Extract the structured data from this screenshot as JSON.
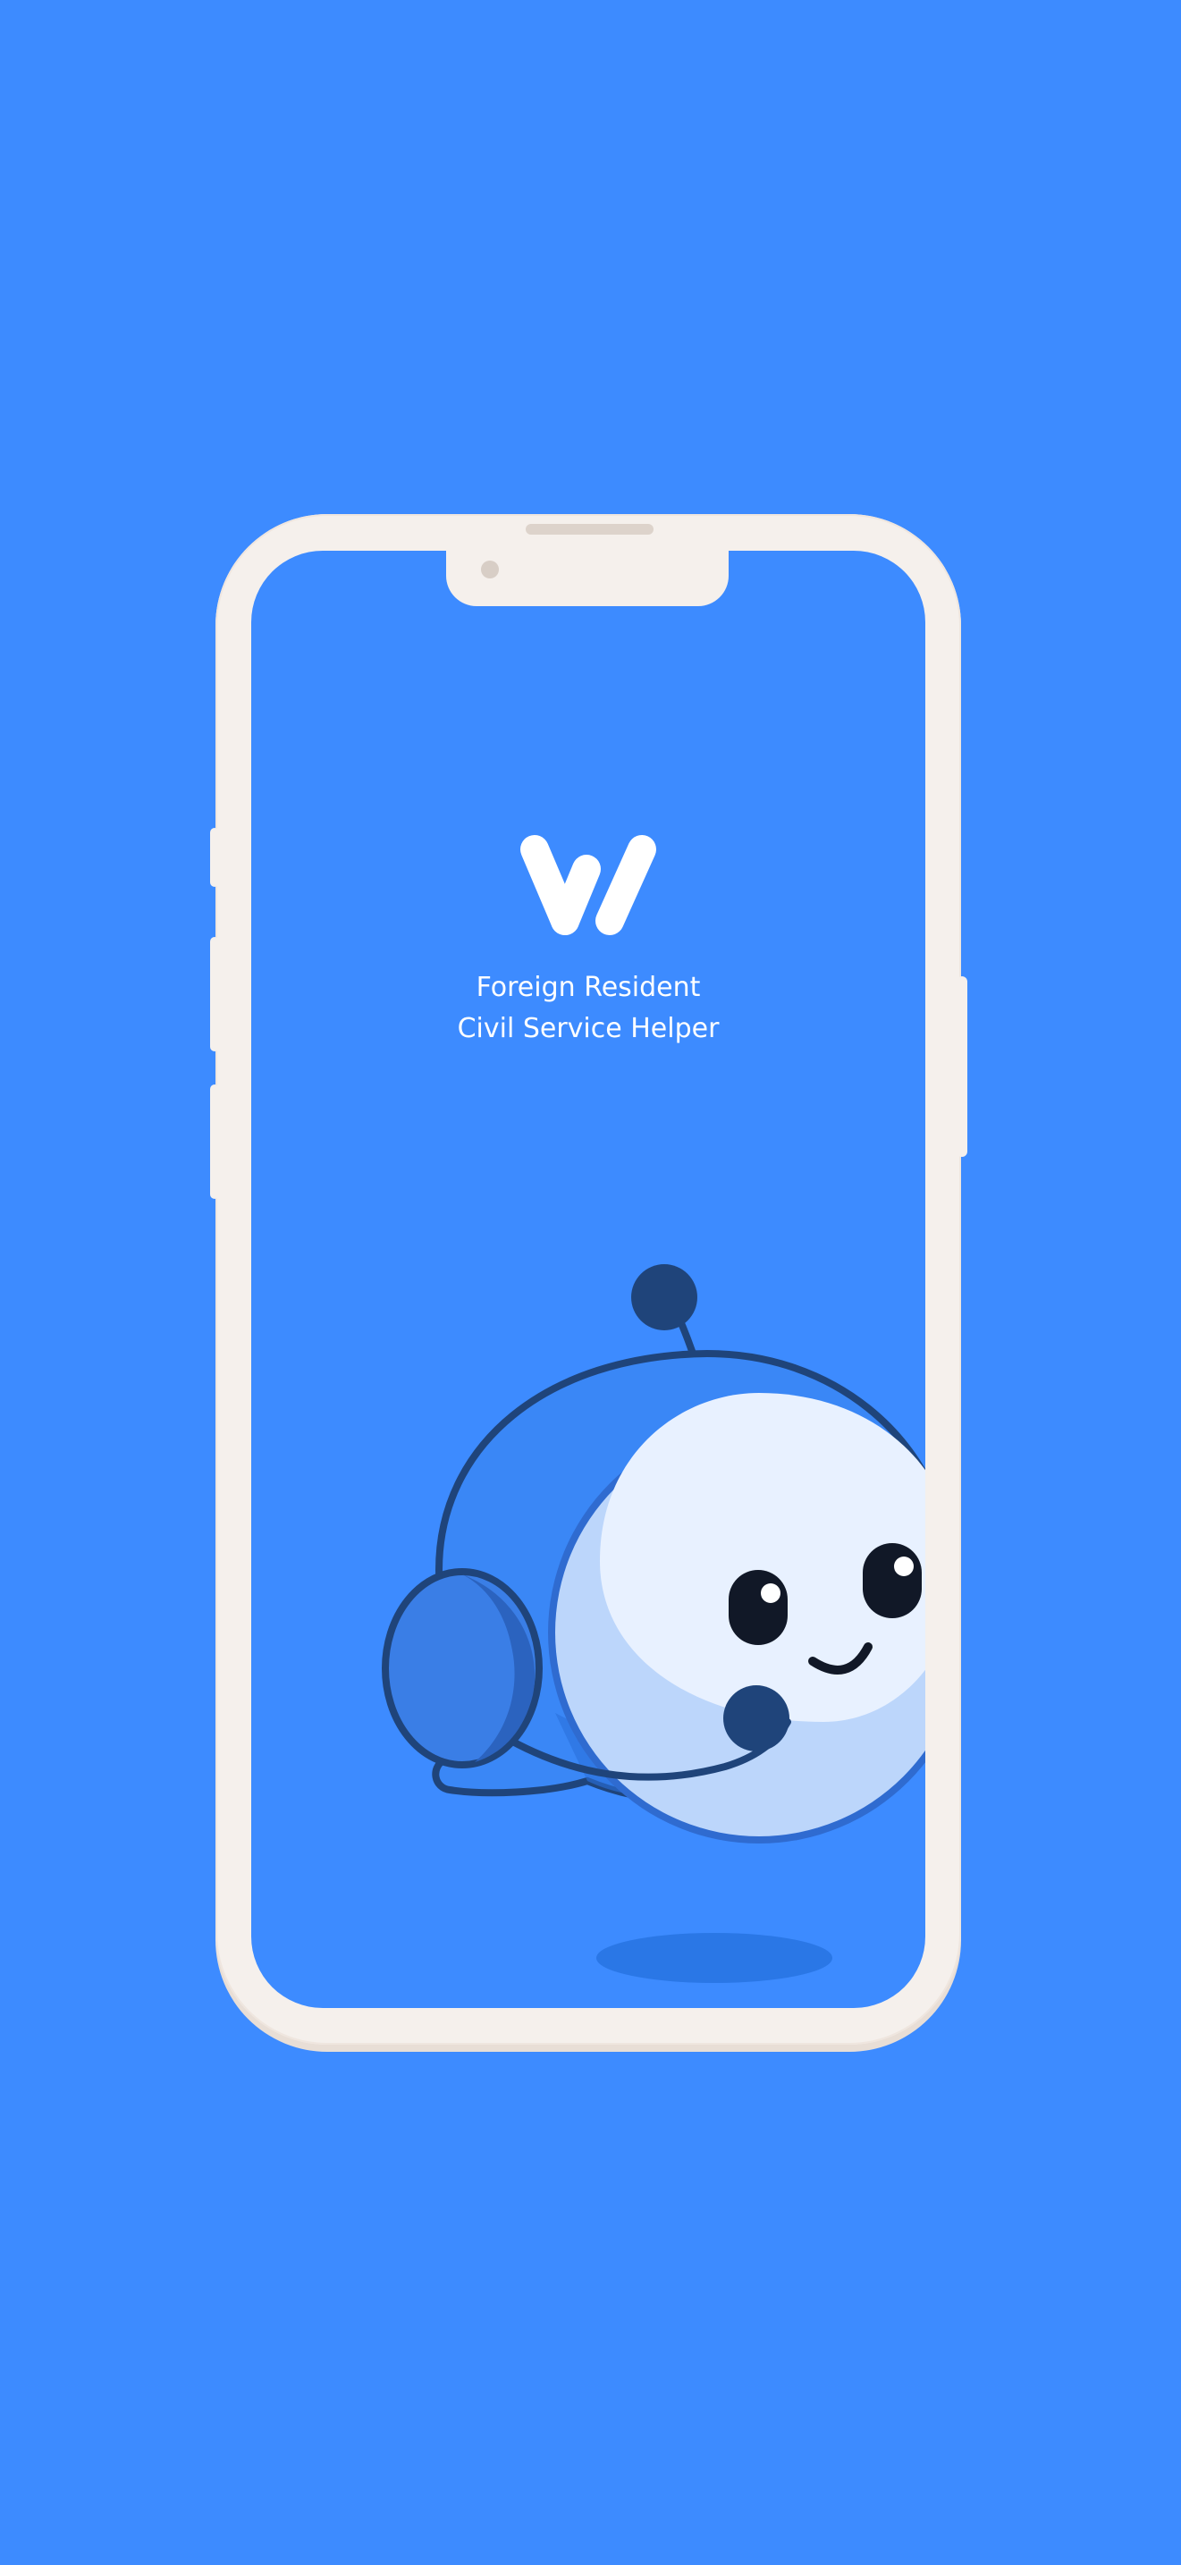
{
  "app": {
    "tagline_line1": "Foreign Resident",
    "tagline_line2": "Civil Service Helper",
    "logo_icon": "w-logo-icon",
    "mascot_icon": "chat-bubble-robot-mascot"
  },
  "colors": {
    "background": "#3d8bff",
    "frame": "#f5f0ec",
    "mascot_outline": "#1f447a",
    "mascot_face": "#e8f1ff",
    "text": "#ffffff"
  }
}
